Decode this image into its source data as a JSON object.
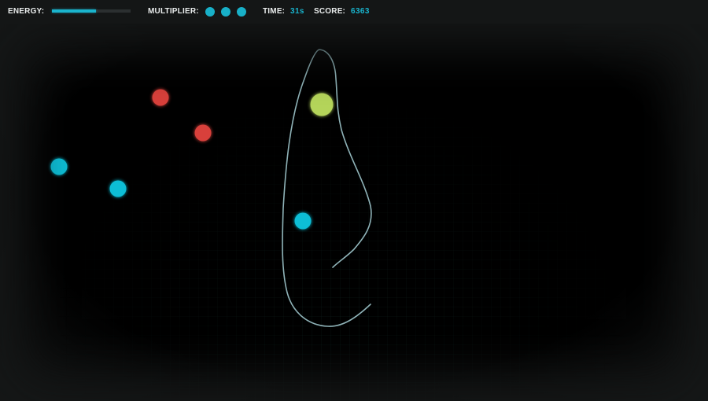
{
  "hud": {
    "energy_label": "ENERGY:",
    "energy_level": 0.56,
    "multiplier_label": "MULTIPLIER:",
    "multiplier_count": 3,
    "time_label": "TIME:",
    "time_value": "31s",
    "score_label": "SCORE:",
    "score_value": "6363"
  },
  "colors": {
    "accent": "#19b3cc",
    "enemy": "#d8403a",
    "collectible": "#10bed6",
    "player": "#b4d45a",
    "trail": "#8fb3b8"
  },
  "entities": {
    "player": {
      "type": "player",
      "color": "#b4d45a"
    },
    "enemies": [
      {
        "type": "enemy",
        "color": "#d8403a"
      },
      {
        "type": "enemy",
        "color": "#d8403a"
      }
    ],
    "collectibles": [
      {
        "type": "collectible",
        "color": "#10bed6"
      },
      {
        "type": "collectible",
        "color": "#10bed6"
      },
      {
        "type": "collectible",
        "color": "#10bed6"
      }
    ]
  }
}
